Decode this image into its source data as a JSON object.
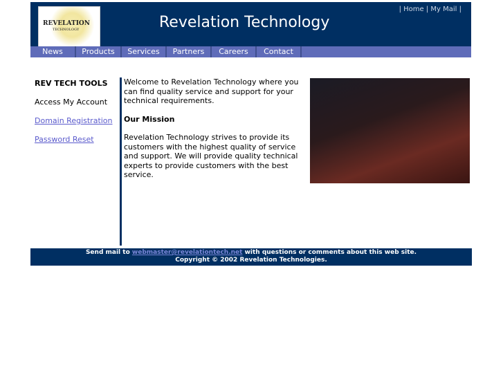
{
  "header": {
    "logo_text": "REVELATION",
    "logo_sub": "TECHNOLOGY",
    "title": "Revelation Technology",
    "links": [
      "Home",
      "My Mail"
    ]
  },
  "nav": [
    "News",
    "Products",
    "Services",
    "Partners",
    "Careers",
    "Contact Us"
  ],
  "sidebar": {
    "heading": "REV TECH TOOLS",
    "items": [
      "Access My Account",
      "Domain Registration",
      "Password Reset"
    ]
  },
  "main": {
    "intro": "Welcome to Revelation Technology where you can find quality service and support for your technical requirements.",
    "mission_heading": "Our Mission",
    "mission": "Revelation Technology strives to provide its customers with the highest quality of service and support. We will provide quality technical experts to provide customers with the best service."
  },
  "footer": {
    "prefix": "Send mail to",
    "email": "webmaster@revelationtech.net",
    "suffix": "with questions or comments about this web site.",
    "copyright": "Copyright © 2002 Revelation Technologies."
  }
}
